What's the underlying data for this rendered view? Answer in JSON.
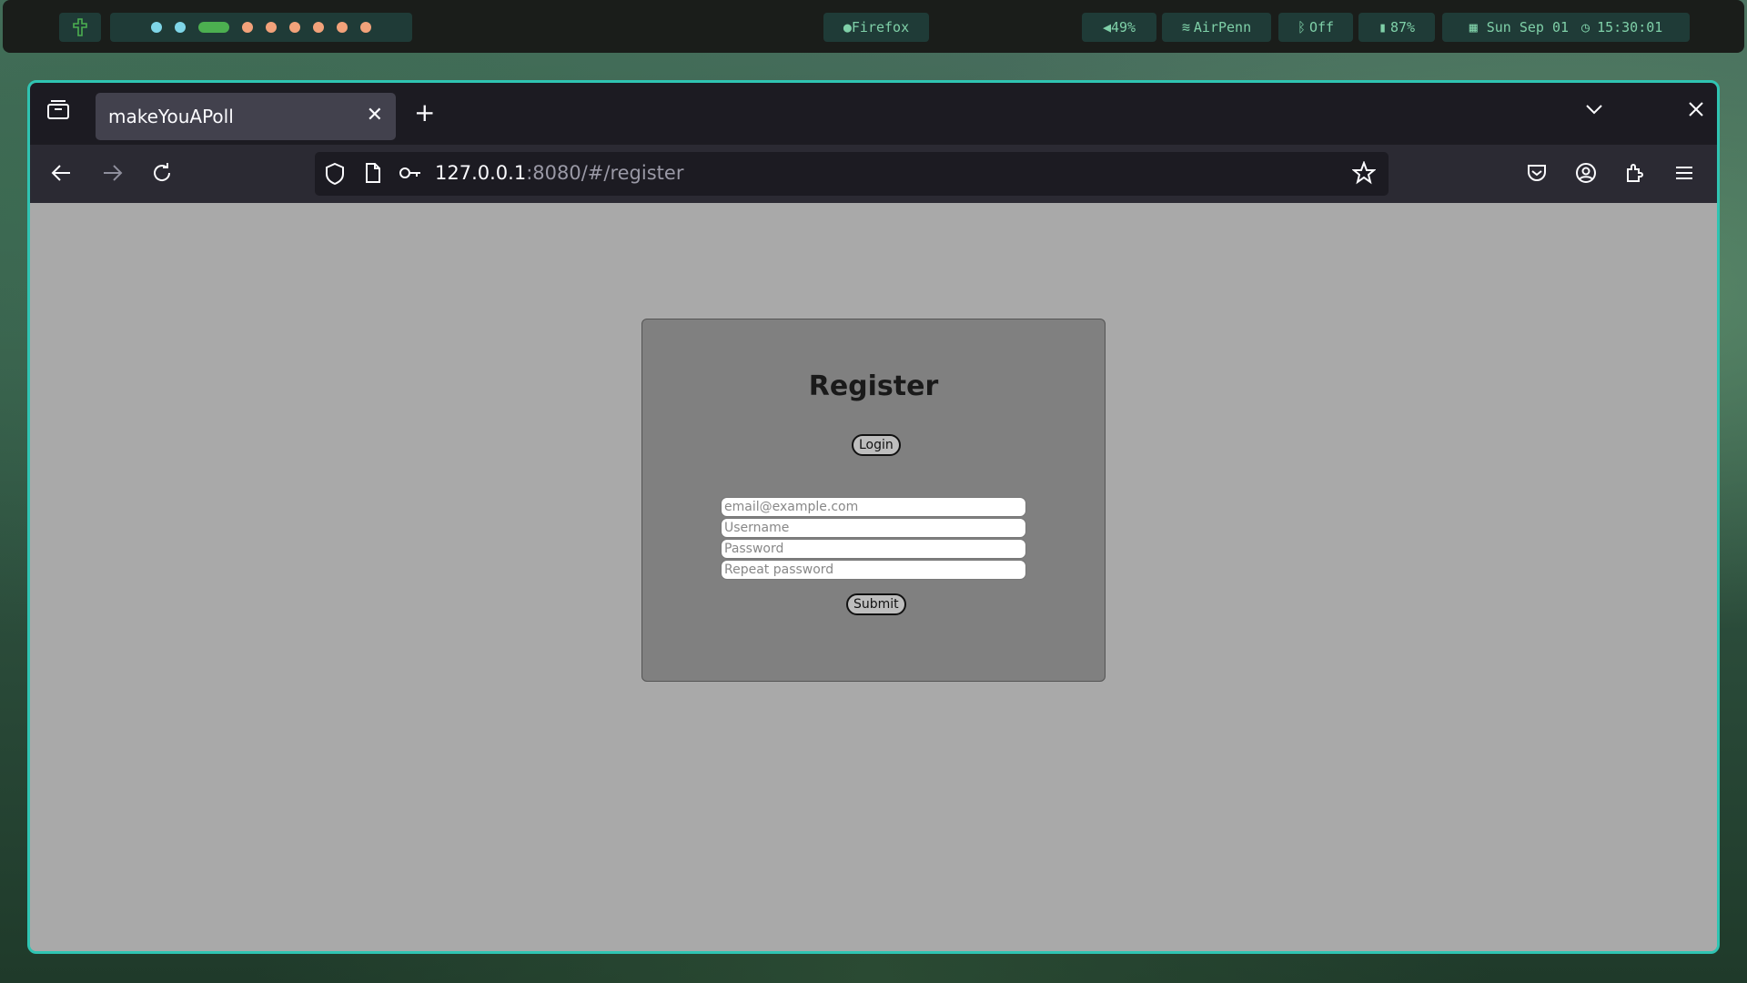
{
  "system_bar": {
    "launcher_icon": "cross-icon",
    "workspace_colors": [
      "#7fd6e8",
      "#7fd6e8",
      "#4caf50",
      "#f2a27a",
      "#f2a27a",
      "#f2a27a",
      "#f2a27a",
      "#f2a27a",
      "#f2a27a"
    ],
    "active_app": "Firefox",
    "volume": "49%",
    "wifi": "AirPenn",
    "bluetooth": "Off",
    "battery": "87%",
    "date": "Sun Sep 01",
    "time": "15:30:01"
  },
  "browser": {
    "tab_title": "makeYouAPoll",
    "url_host": "127.0.0.1",
    "url_rest": ":8080/#/register"
  },
  "page": {
    "title": "Register",
    "login_label": "Login",
    "email_placeholder": "email@example.com",
    "username_placeholder": "Username",
    "password_placeholder": "Password",
    "repeat_password_placeholder": "Repeat password",
    "submit_label": "Submit"
  }
}
